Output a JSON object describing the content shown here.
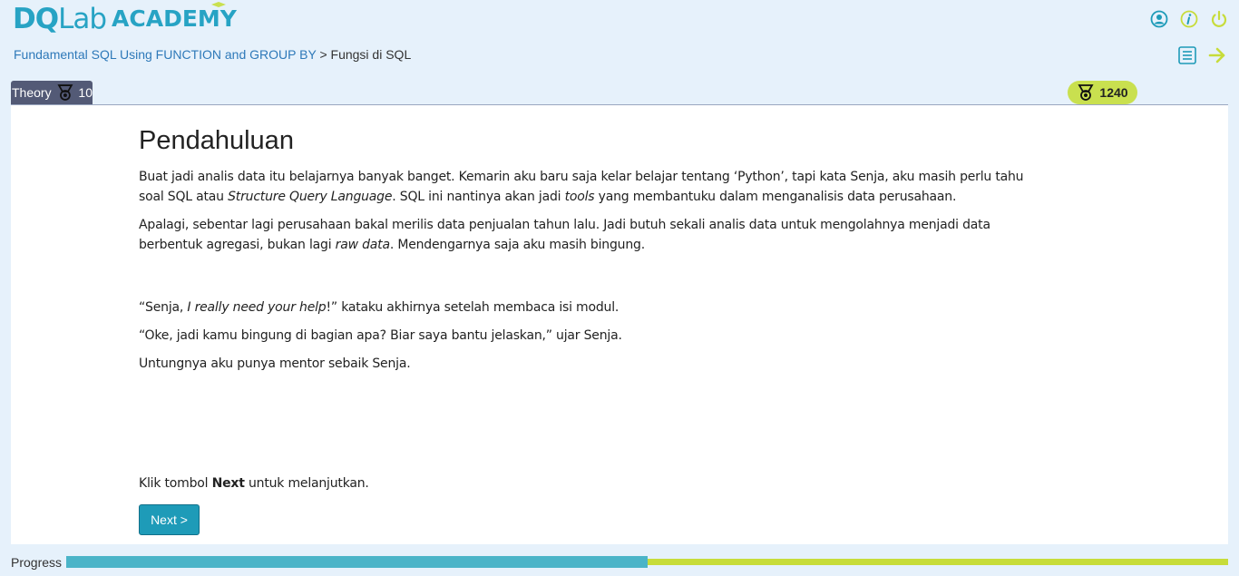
{
  "header": {
    "logo_brand_main": "DQ",
    "logo_brand_lab": "Lab",
    "logo_academy": "ACADEMY",
    "icons": [
      "profile-icon",
      "info-icon",
      "power-icon"
    ]
  },
  "breadcrumb": {
    "course": "Fundamental SQL Using FUNCTION and GROUP BY",
    "separator": ">",
    "chapter": "Fungsi di SQL"
  },
  "nav_icons": [
    "list-icon",
    "next-arrow-icon"
  ],
  "tab": {
    "label": "Theory",
    "points": "10"
  },
  "score": {
    "value": "1240"
  },
  "lesson": {
    "title": "Pendahuluan",
    "p1_a": "Buat jadi analis data itu belajarnya banyak banget. Kemarin aku baru saja kelar belajar tentang ‘Python’, tapi kata Senja, aku masih perlu tahu soal SQL atau ",
    "p1_em1": "Structure Query Language",
    "p1_b": ". SQL ini nantinya akan jadi ",
    "p1_em2": "tools",
    "p1_c": " yang membantuku dalam menganalisis data perusahaan.",
    "p2_a": "Apalagi, sebentar lagi perusahaan bakal merilis data penjualan tahun lalu. Jadi butuh sekali analis data untuk mengolahnya menjadi data berbentuk agregasi, bukan lagi ",
    "p2_em": "raw data",
    "p2_b": ". Mendengarnya saja aku masih bingung.",
    "p3_a": "“Senja, ",
    "p3_em": "I really need your help",
    "p3_b": "!” kataku akhirnya setelah membaca isi modul.",
    "p4": "“Oke, jadi kamu bingung di bagian apa? Biar saya bantu jelaskan,” ujar Senja.",
    "p5": "Untungnya aku punya mentor sebaik Senja.",
    "instr_a": "Klik tombol ",
    "instr_b": "Next",
    "instr_c": " untuk melanjutkan.",
    "next_button": "Next >"
  },
  "progress": {
    "label": "Progress",
    "fraction": 0.5
  },
  "colors": {
    "brand": "#27a3c4",
    "score_pill": "#c9e04f",
    "tab": "#535a76",
    "button": "#1e9bb8",
    "progress_fill": "#4bb4c8",
    "progress_track": "#c7dc3a"
  }
}
